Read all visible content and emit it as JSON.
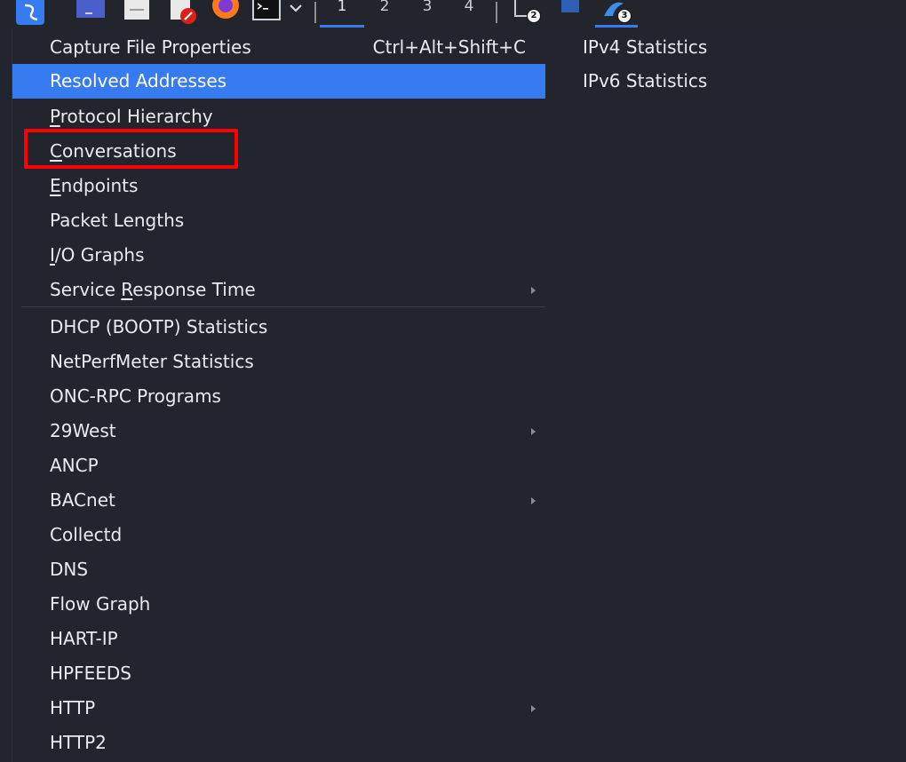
{
  "colors": {
    "accent": "#367bf0",
    "menu_bg": "#23252e",
    "text": "#e9eaee",
    "highlight_box": "#ff0000"
  },
  "taskbar": {
    "apps": [
      {
        "name": "kali-menu-icon"
      },
      {
        "name": "desktop-icon"
      },
      {
        "name": "files-icon"
      },
      {
        "name": "text-editor-icon"
      },
      {
        "name": "firefox-icon"
      },
      {
        "name": "terminal-icon"
      },
      {
        "name": "chevron-down-icon"
      }
    ],
    "workspaces": [
      "1",
      "2",
      "3",
      "4"
    ],
    "active_workspace": "1",
    "windows": [
      {
        "name": "terminal-window-icon",
        "badge": "2"
      },
      {
        "name": "blue-window-icon",
        "badge": ""
      },
      {
        "name": "wireshark-window-icon",
        "badge": "3"
      }
    ]
  },
  "statistics_menu": {
    "items": [
      {
        "label": "Capture File Properties",
        "shortcut": "Ctrl+Alt+Shift+C"
      },
      {
        "label": "Resolved Addresses"
      },
      {
        "label": "Protocol Hierarchy",
        "mnemonic": "P",
        "rest": "rotocol Hierarchy"
      },
      {
        "label": "Conversations",
        "mnemonic": "C",
        "rest": "onversations"
      },
      {
        "label": "Endpoints",
        "mnemonic": "E",
        "rest": "ndpoints"
      },
      {
        "label": "Packet Lengths"
      },
      {
        "label": "I/O Graphs",
        "mnemonic": "I",
        "rest": "/O Graphs"
      },
      {
        "label": "Service Response Time",
        "pre": "Service ",
        "mnemonic": "R",
        "rest": "esponse Time"
      },
      {
        "label": "DHCP (BOOTP) Statistics"
      },
      {
        "label": "NetPerfMeter Statistics"
      },
      {
        "label": "ONC-RPC Programs"
      },
      {
        "label": "29West"
      },
      {
        "label": "ANCP"
      },
      {
        "label": "BACnet"
      },
      {
        "label": "Collectd"
      },
      {
        "label": "DNS"
      },
      {
        "label": "Flow Graph"
      },
      {
        "label": "HART-IP"
      },
      {
        "label": "HPFEEDS"
      },
      {
        "label": "HTTP"
      },
      {
        "label": "HTTP2"
      }
    ],
    "selected": "Resolved Addresses",
    "highlighted": "Conversations"
  },
  "submenu": {
    "items": [
      "IPv4 Statistics",
      "IPv6 Statistics"
    ]
  }
}
